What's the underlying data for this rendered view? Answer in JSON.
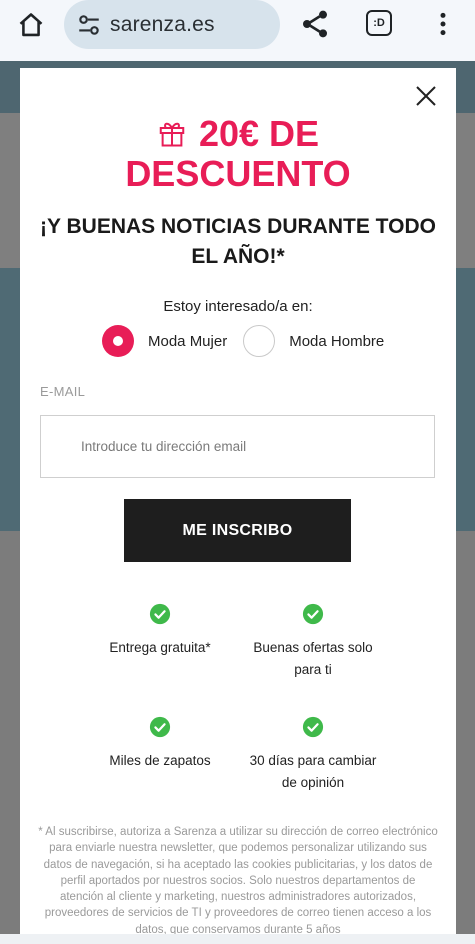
{
  "browser": {
    "url": "sarenza.es",
    "tab_label": ":D"
  },
  "modal": {
    "headline_line1": "20€ DE",
    "headline_line2": "DESCUENTO",
    "subheadline": "¡Y BUENAS NOTICIAS DURANTE TODO EL AÑO!*",
    "interest_label": "Estoy interesado/a en:",
    "radio_options": [
      {
        "label": "Moda Mujer",
        "selected": true
      },
      {
        "label": "Moda Hombre",
        "selected": false
      }
    ],
    "email_label": "E-MAIL",
    "email_placeholder": "Introduce tu dirección email",
    "email_value": "",
    "submit_label": "ME INSCRIBO",
    "benefits": [
      "Entrega gratuita*",
      "Buenas ofertas solo para ti",
      "Miles de zapatos",
      "30 días para cambiar de opinión"
    ],
    "legal_text": "* Al suscribirse, autoriza a Sarenza a utilizar su dirección de correo electrónico para enviarle nuestra newsletter, que podemos personalizar utilizando sus datos de navegación, si ha aceptado las cookies publicitarias, y los datos de perfil aportados por nuestros socios. Solo nuestros departamentos de atención al cliente y marketing, nuestros administradores autorizados, proveedores de servicios de TI y proveedores de correo tienen acceso a los datos, que conservamos durante 5 años"
  },
  "colors": {
    "accent": "#e81d57",
    "check": "#3fb94a",
    "button": "#1e1e1e"
  },
  "icons": [
    "home-icon",
    "tune-icon",
    "share-icon",
    "more-vert-icon",
    "close-icon",
    "gift-icon",
    "check-circle-icon"
  ]
}
